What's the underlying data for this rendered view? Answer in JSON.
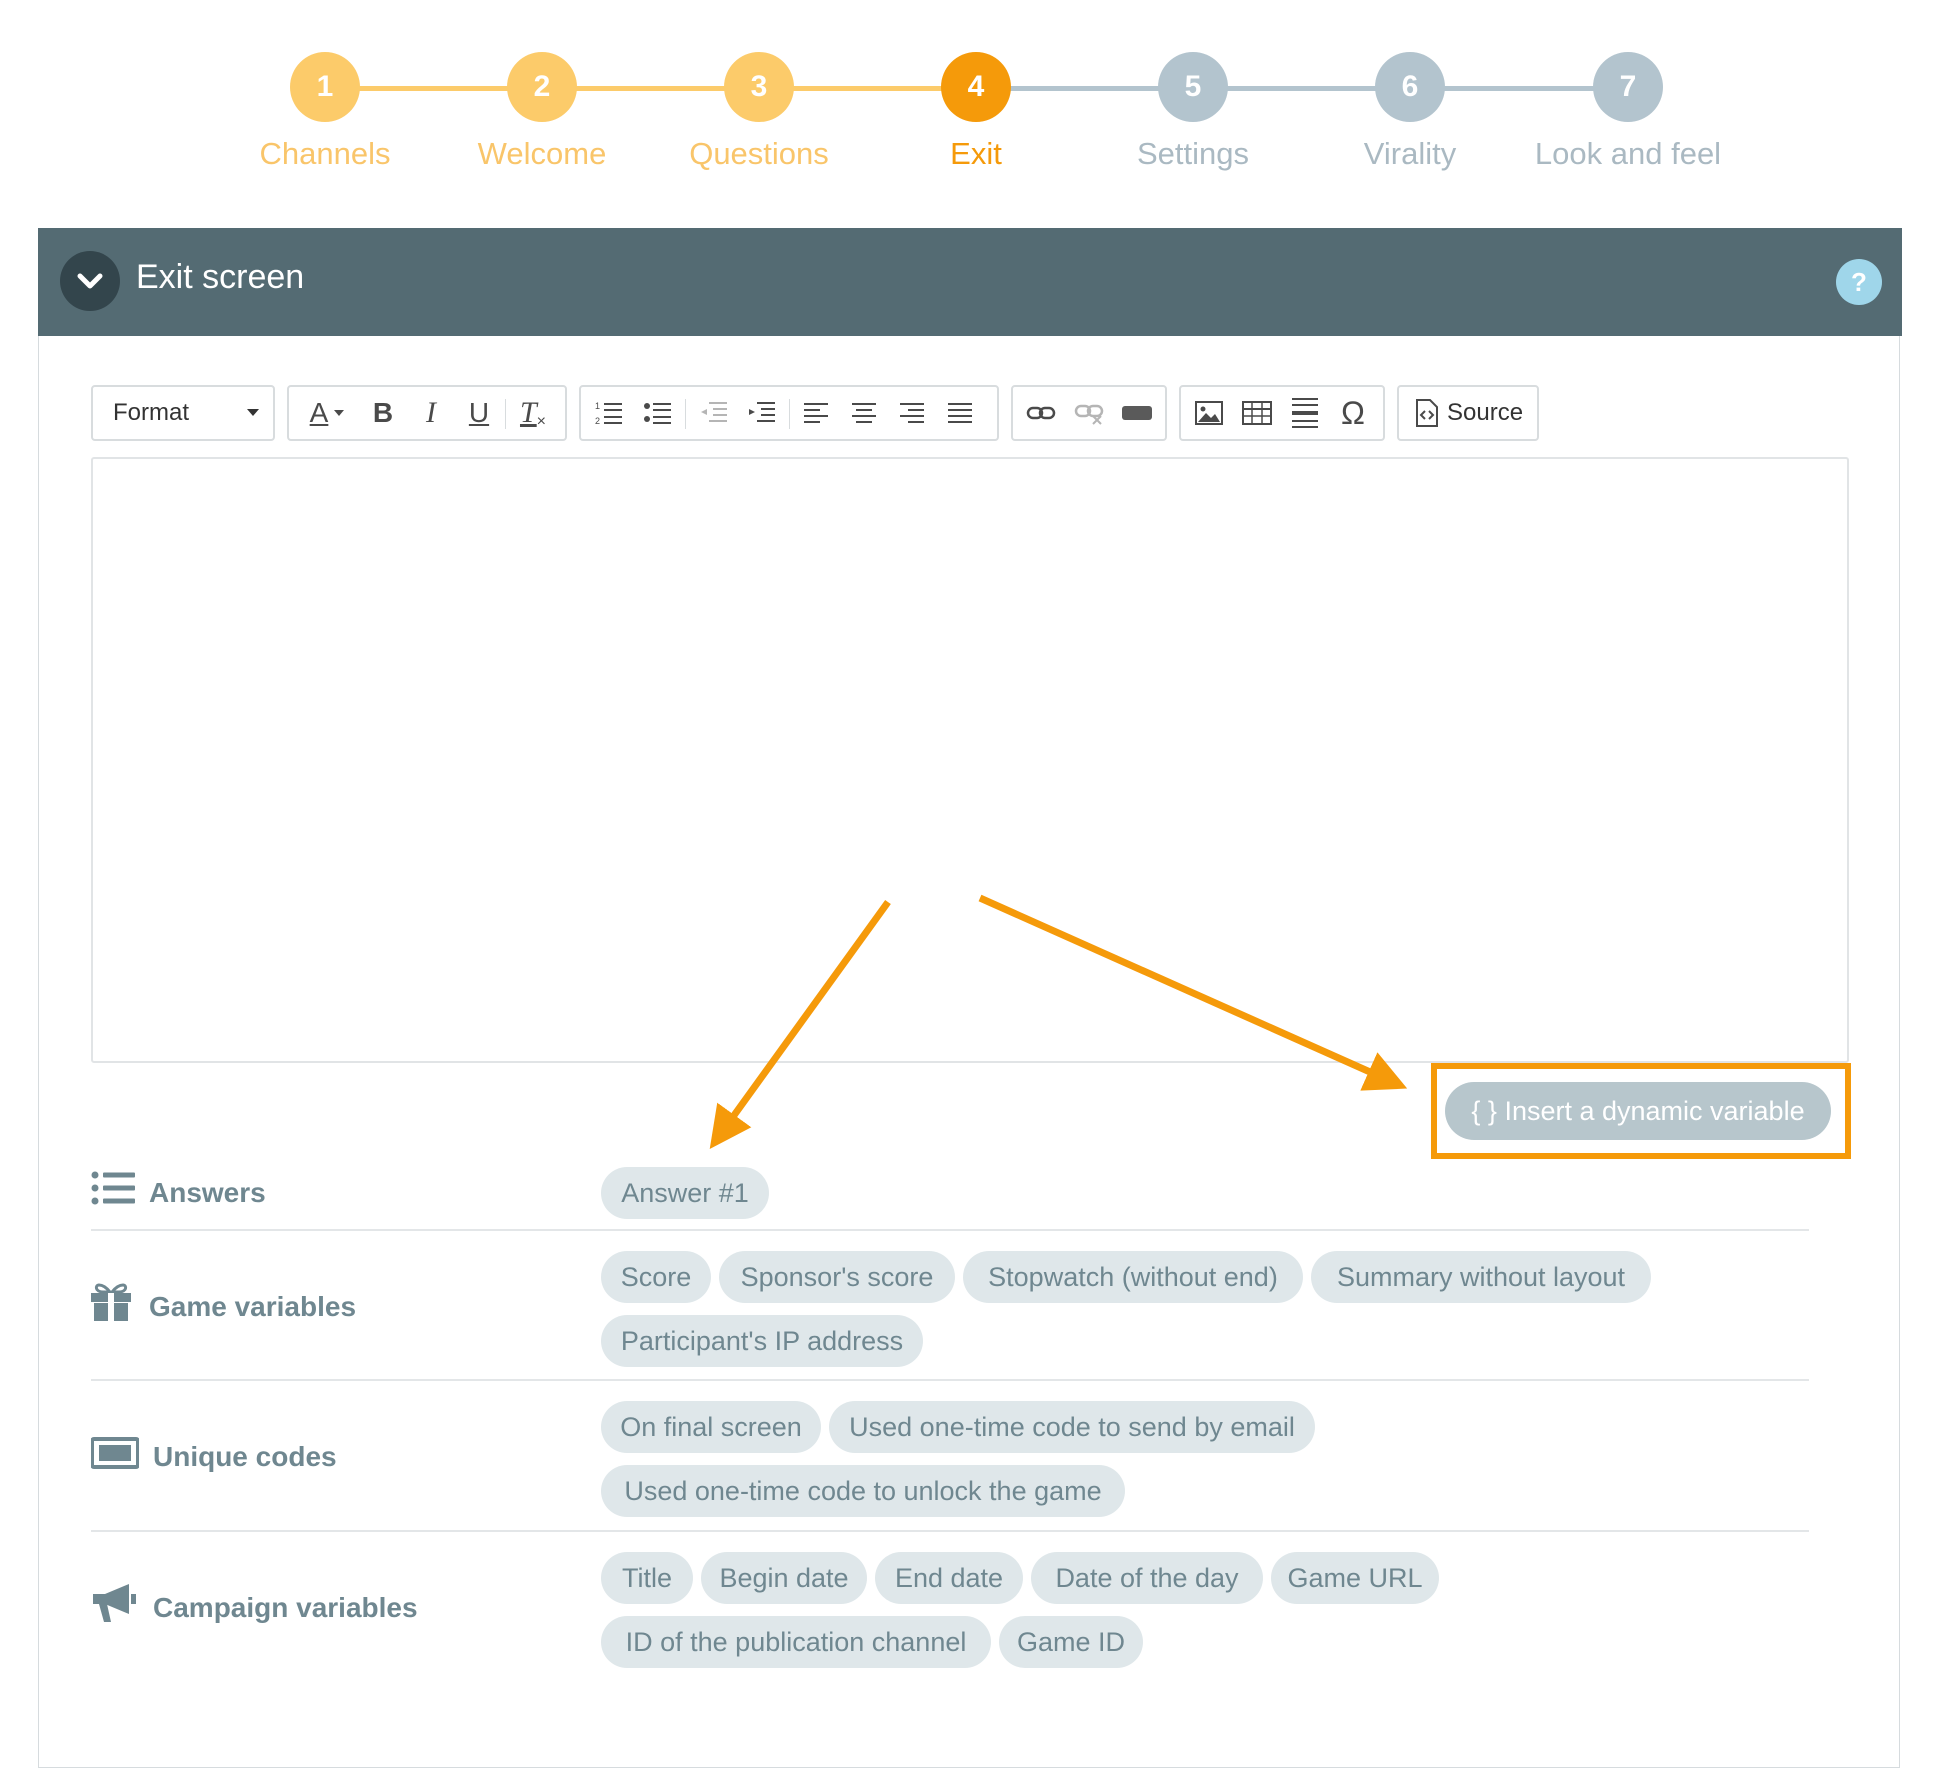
{
  "stepper": {
    "steps": [
      {
        "num": "1",
        "label": "Channels"
      },
      {
        "num": "2",
        "label": "Welcome"
      },
      {
        "num": "3",
        "label": "Questions"
      },
      {
        "num": "4",
        "label": "Exit"
      },
      {
        "num": "5",
        "label": "Settings"
      },
      {
        "num": "6",
        "label": "Virality"
      },
      {
        "num": "7",
        "label": "Look and feel"
      }
    ],
    "current_step": 4,
    "colors": {
      "done": "#fccb6a",
      "done_text": "#f9c56a",
      "current": "#f59a0a",
      "pending": "#b3c4ce",
      "pending_text": "#aab9c2"
    }
  },
  "panel": {
    "title": "Exit screen",
    "help_label": "?",
    "header_color": "#546b73"
  },
  "toolbar": {
    "format_label": "Format",
    "source_label": "Source",
    "icons": [
      "text-color-icon",
      "bold-icon",
      "italic-icon",
      "underline-icon",
      "remove-format-icon",
      "numbered-list-icon",
      "bulleted-list-icon",
      "outdent-icon",
      "indent-icon",
      "align-left-icon",
      "align-center-icon",
      "align-right-icon",
      "align-justify-icon",
      "link-icon",
      "unlink-icon",
      "button-icon",
      "image-icon",
      "table-icon",
      "horizontal-line-icon",
      "special-char-icon",
      "source-icon"
    ],
    "bold_glyph": "B",
    "italic_glyph": "I",
    "underline_glyph": "U",
    "text_color_glyph": "A",
    "remove_format_glyph": "T",
    "omega_glyph": "Ω"
  },
  "insert_variable": {
    "label": "{ } Insert a dynamic variable",
    "highlight_color": "#f59a0a"
  },
  "sections": {
    "answers": {
      "label": "Answers",
      "chips": [
        "Answer #1"
      ]
    },
    "game": {
      "label": "Game variables",
      "chips": [
        "Score",
        "Sponsor's score",
        "Stopwatch (without end)",
        "Summary without layout",
        "Participant's IP address"
      ]
    },
    "codes": {
      "label": "Unique codes",
      "chips": [
        "On final screen",
        "Used one-time code to send by email",
        "Used one-time code to unlock the game"
      ]
    },
    "campaign": {
      "label": "Campaign variables",
      "chips": [
        "Title",
        "Begin date",
        "End date",
        "Date of the day",
        "Game URL",
        "ID of the publication channel",
        "Game ID"
      ]
    }
  },
  "annotation_arrow_color": "#f59a0a"
}
